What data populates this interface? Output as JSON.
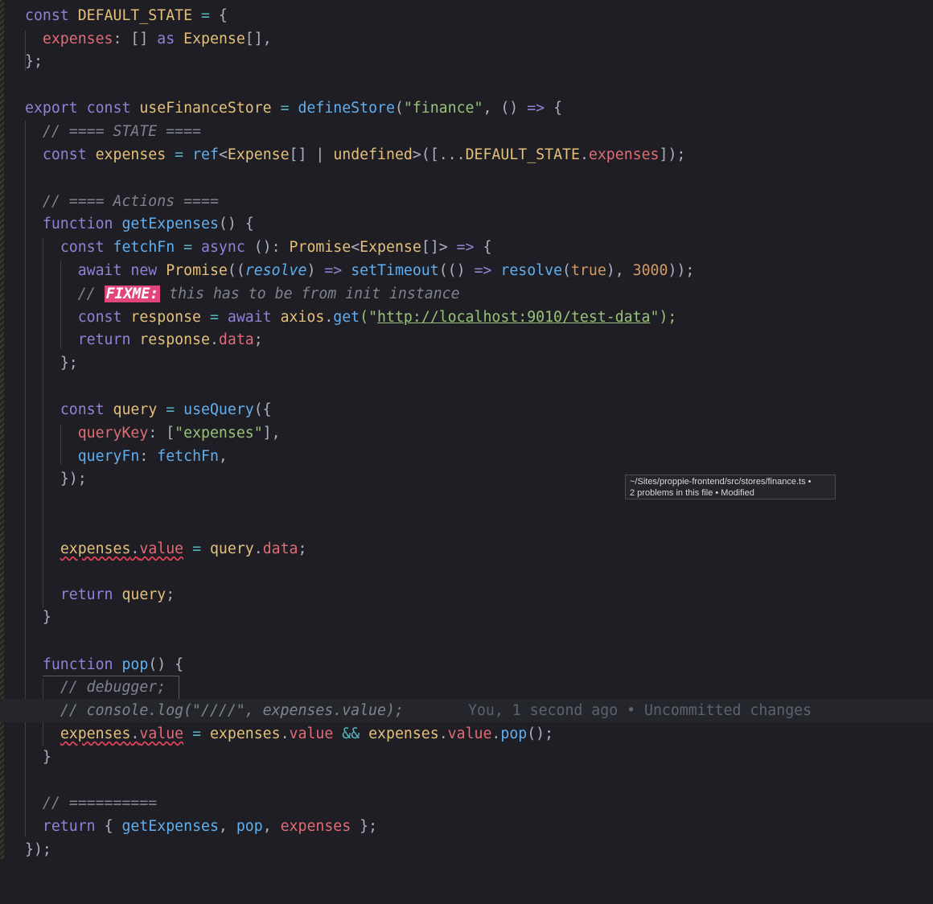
{
  "editor": {
    "file_path": "~/Sites/proppie-frontend/src/stores/finance.ts",
    "tooltip": {
      "line1": "~/Sites/proppie-frontend/src/stores/finance.ts •",
      "line2": "2 problems in this file • Modified"
    },
    "blame": "You, 1 second ago • Uncommitted changes"
  },
  "code": {
    "l1": [
      "const",
      "DEFAULT_STATE",
      "=",
      "{"
    ],
    "l2": [
      "expenses",
      ":",
      "[]",
      "as",
      "Expense",
      "[],"
    ],
    "l3": [
      "};"
    ],
    "l5": [
      "export",
      "const",
      "useFinanceStore",
      "=",
      "defineStore",
      "(",
      "\"finance\"",
      ",",
      "()",
      "=>",
      "{"
    ],
    "l6": [
      "// ==== STATE ===="
    ],
    "l7": [
      "const",
      "expenses",
      "=",
      "ref",
      "<",
      "Expense",
      "[]",
      "|",
      "undefined",
      ">([...",
      "DEFAULT_STATE",
      ".",
      "expenses",
      "]);"
    ],
    "l9": [
      "// ==== Actions ===="
    ],
    "l10": [
      "function",
      "getExpenses",
      "() {"
    ],
    "l11": [
      "const",
      "fetchFn",
      "=",
      "async",
      "():",
      "Promise",
      "<",
      "Expense",
      "[]",
      ">",
      "=>",
      "{"
    ],
    "l12": [
      "await",
      "new",
      "Promise",
      "((",
      "resolve",
      ")",
      "=>",
      "setTimeout",
      "(()",
      "=>",
      "resolve",
      "(",
      "true",
      "),",
      "3000",
      "));"
    ],
    "l13": [
      "//",
      "FIXME:",
      "this has to be from init instance"
    ],
    "l14": [
      "const",
      "response",
      "=",
      "await",
      "axios",
      ".",
      "get",
      "(\"",
      "http://localhost:9010/test-data",
      "\");"
    ],
    "l15": [
      "return",
      "response",
      ".",
      "data",
      ";"
    ],
    "l16": [
      "};"
    ],
    "l18": [
      "const",
      "query",
      "=",
      "useQuery",
      "({"
    ],
    "l19": [
      "queryKey",
      ":",
      "[",
      "\"expenses\"",
      "],"
    ],
    "l20": [
      "queryFn",
      ":",
      "fetchFn",
      ","
    ],
    "l21": [
      "});"
    ],
    "l24": [
      "expenses",
      ".",
      "value",
      "=",
      "query",
      ".",
      "data",
      ";"
    ],
    "l26": [
      "return",
      "query",
      ";"
    ],
    "l27": [
      "}"
    ],
    "l29": [
      "function",
      "pop",
      "() {"
    ],
    "l30": [
      "// debugger;"
    ],
    "l31": [
      "// console.log(\"////\", expenses.value);"
    ],
    "l32": [
      "expenses",
      ".",
      "value",
      "=",
      "expenses",
      ".",
      "value",
      "&&",
      "expenses",
      ".",
      "value",
      ".",
      "pop",
      "();"
    ],
    "l33": [
      "}"
    ],
    "l35": [
      "// =========="
    ],
    "l36": [
      "return",
      "{",
      "getExpenses",
      ",",
      "pop",
      ",",
      "expenses",
      "};"
    ],
    "l37": [
      "});"
    ]
  }
}
